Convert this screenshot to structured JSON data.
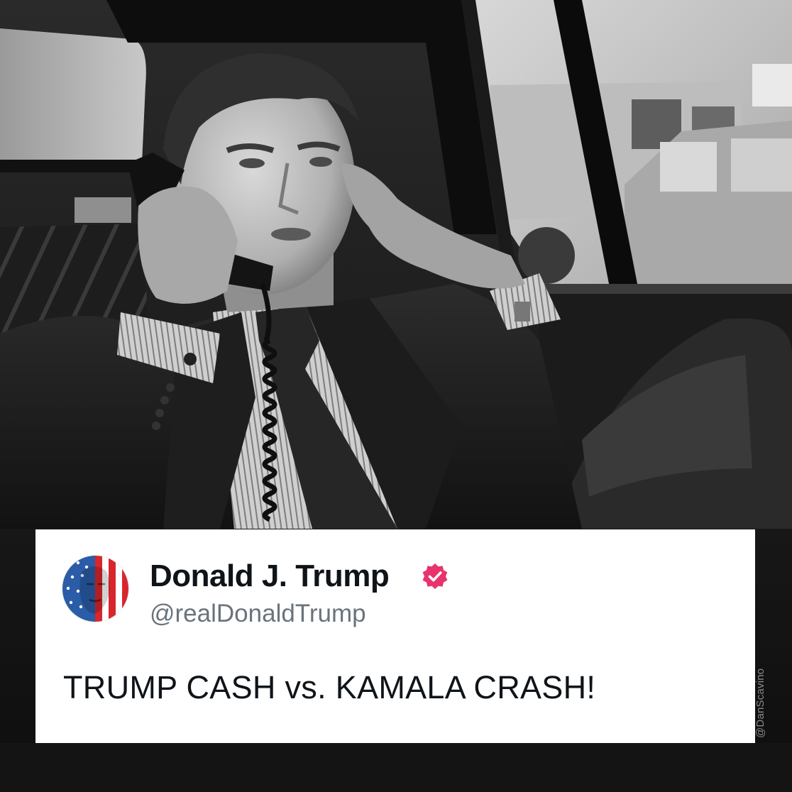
{
  "post": {
    "display_name": "Donald J. Trump",
    "handle": "@realDonaldTrump",
    "text": "TRUMP CASH vs. KAMALA CRASH!",
    "verified_color": "#e8336d"
  },
  "watermark": {
    "text": "@DanScavino"
  },
  "photo": {
    "style": "black-and-white",
    "subject": "man on corded phone in car back seat"
  },
  "avatar": {
    "icon": "flag-portrait-avatar-icon"
  }
}
